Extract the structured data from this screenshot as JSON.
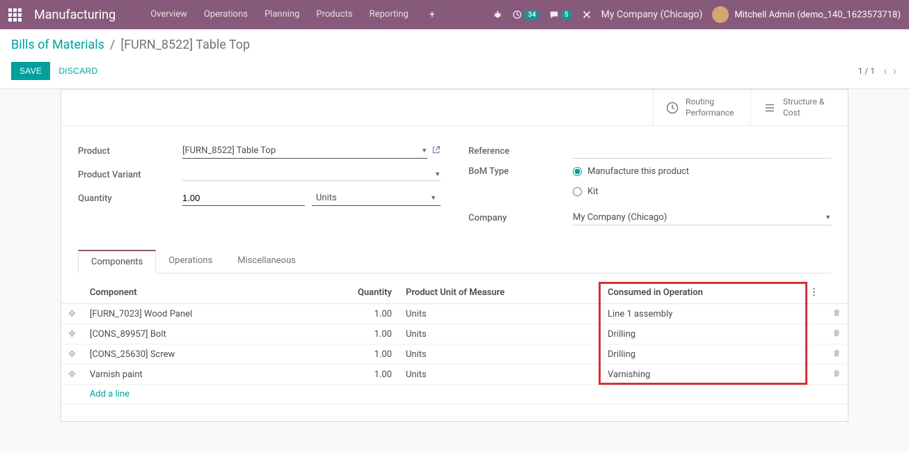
{
  "navbar": {
    "brand": "Manufacturing",
    "links": [
      "Overview",
      "Operations",
      "Planning",
      "Products",
      "Reporting"
    ],
    "activity_count": "34",
    "discuss_count": "5",
    "company": "My Company (Chicago)",
    "user": "Mitchell Admin (demo_140_1623573718)"
  },
  "breadcrumb": {
    "parent": "Bills of Materials",
    "current": "[FURN_8522] Table Top"
  },
  "buttons": {
    "save": "SAVE",
    "discard": "DISCARD"
  },
  "pager": {
    "pos": "1 / 1"
  },
  "stat_buttons": {
    "routing": "Routing\nPerformance",
    "structure": "Structure &\nCost"
  },
  "form": {
    "product_label": "Product",
    "product_value": "[FURN_8522] Table Top",
    "variant_label": "Product Variant",
    "variant_value": "",
    "qty_label": "Quantity",
    "qty_value": "1.00",
    "qty_uom": "Units",
    "ref_label": "Reference",
    "ref_value": "",
    "bom_type_label": "BoM Type",
    "bom_type_opt1": "Manufacture this product",
    "bom_type_opt2": "Kit",
    "company_label": "Company",
    "company_value": "My Company (Chicago)"
  },
  "tabs": {
    "components": "Components",
    "operations": "Operations",
    "misc": "Miscellaneous"
  },
  "table": {
    "headers": {
      "component": "Component",
      "quantity": "Quantity",
      "uom": "Product Unit of Measure",
      "consumed": "Consumed in Operation"
    },
    "rows": [
      {
        "component": "[FURN_7023] Wood Panel",
        "qty": "1.00",
        "uom": "Units",
        "consumed": "Line 1 assembly"
      },
      {
        "component": "[CONS_89957] Bolt",
        "qty": "1.00",
        "uom": "Units",
        "consumed": "Drilling"
      },
      {
        "component": "[CONS_25630] Screw",
        "qty": "1.00",
        "uom": "Units",
        "consumed": "Drilling"
      },
      {
        "component": "Varnish paint",
        "qty": "1.00",
        "uom": "Units",
        "consumed": "Varnishing"
      }
    ],
    "add_line": "Add a line"
  }
}
